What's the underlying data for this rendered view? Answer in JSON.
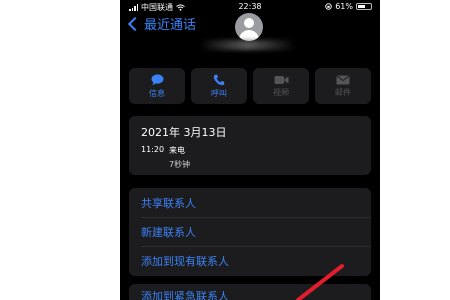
{
  "status_bar": {
    "carrier": "中国联通",
    "time": "22:38",
    "battery_percent": "61%",
    "battery_level": 0.61
  },
  "nav": {
    "back_label": "最近通话"
  },
  "actions": [
    {
      "label": "信息",
      "icon": "message-icon",
      "enabled": true
    },
    {
      "label": "呼叫",
      "icon": "phone-icon",
      "enabled": true
    },
    {
      "label": "视频",
      "icon": "video-icon",
      "enabled": false
    },
    {
      "label": "邮件",
      "icon": "mail-icon",
      "enabled": false
    }
  ],
  "call_info": {
    "date": "2021年 3月13日",
    "time": "11:20",
    "type": "来电",
    "duration": "7秒钟"
  },
  "menu": [
    {
      "label": "共享联系人"
    },
    {
      "label": "新建联系人"
    },
    {
      "label": "添加到现有联系人"
    }
  ],
  "menu2": [
    {
      "label": "添加到紧急联系人"
    }
  ],
  "colors": {
    "accent": "#3b82f6",
    "background": "#000000",
    "card": "#1c1c1e",
    "annotation": "#e11d2e"
  }
}
